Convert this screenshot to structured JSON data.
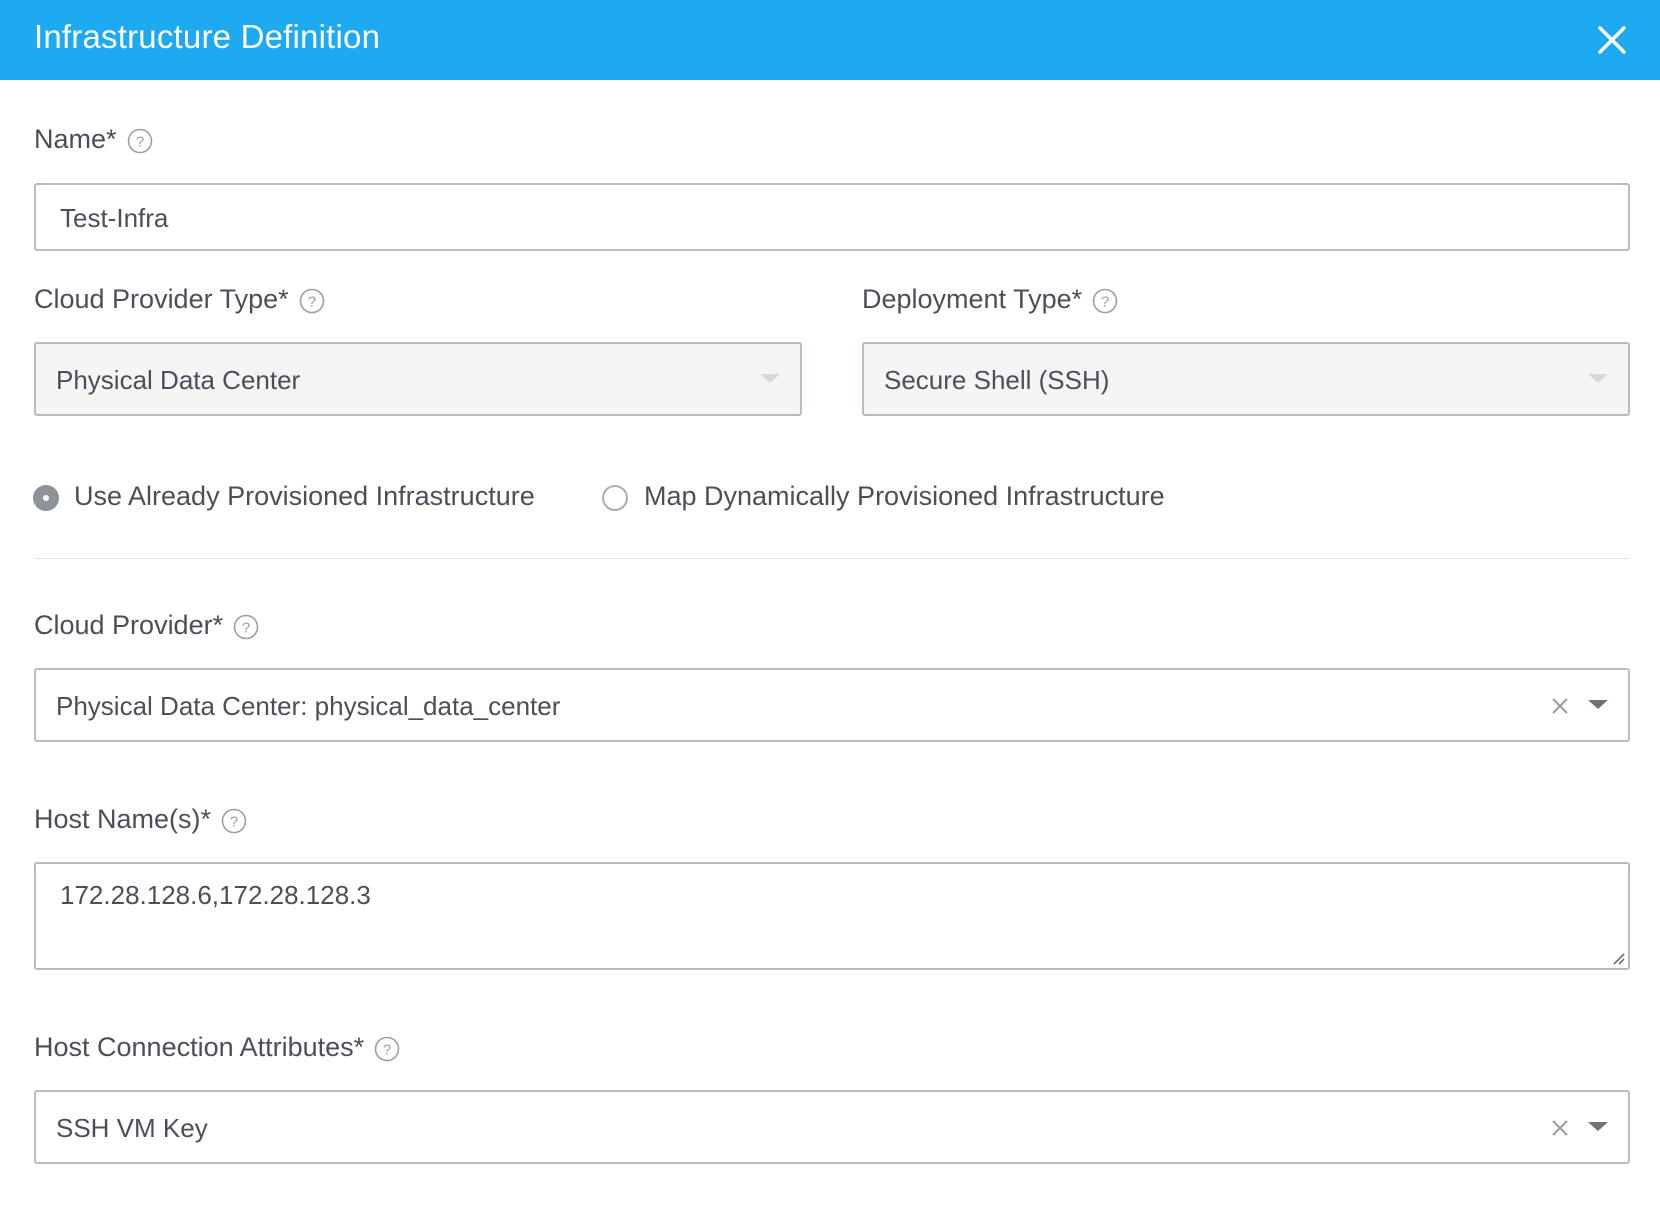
{
  "dialog": {
    "title": "Infrastructure Definition",
    "close_icon": "close-icon",
    "header_color": "#1eaaf1"
  },
  "fields": {
    "name": {
      "label": "Name*",
      "value": "Test-Infra",
      "help_icon": "help-icon"
    },
    "cloud_provider_type": {
      "label": "Cloud Provider Type*",
      "value": "Physical Data Center",
      "help_icon": "help-icon"
    },
    "deployment_type": {
      "label": "Deployment Type*",
      "value": "Secure Shell (SSH)",
      "help_icon": "help-icon"
    },
    "provisioning": {
      "options": [
        {
          "label": "Use Already Provisioned Infrastructure",
          "selected": true
        },
        {
          "label": "Map Dynamically Provisioned Infrastructure",
          "selected": false
        }
      ]
    },
    "cloud_provider": {
      "label": "Cloud Provider*",
      "value": "Physical Data Center: physical_data_center",
      "help_icon": "help-icon"
    },
    "host_names": {
      "label": "Host Name(s)*",
      "value": "172.28.128.6,172.28.128.3",
      "help_icon": "help-icon"
    },
    "host_connection_attributes": {
      "label": "Host Connection Attributes*",
      "value": "SSH VM Key",
      "help_icon": "help-icon"
    }
  }
}
